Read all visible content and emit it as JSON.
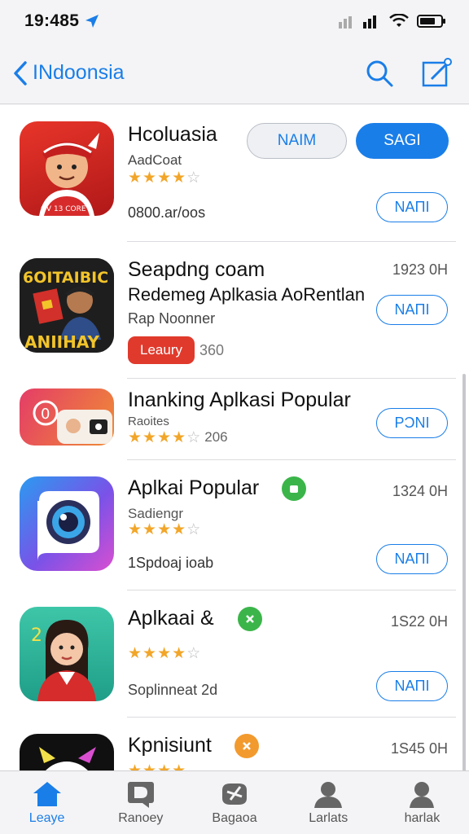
{
  "status": {
    "time": "19:485"
  },
  "nav": {
    "back_label": "INdoonsia"
  },
  "rows": [
    {
      "title": "Hcoluasia",
      "subtitle": "AadCoat",
      "meta": "0800.ar/oos",
      "btn_secondary": "NAIM",
      "btn_primary": "SAGI",
      "btn": "NAΠI",
      "rating": 4.5
    },
    {
      "title": "Seapdng coam",
      "subtitle": "Redemeg Aplkasia AoRentlan",
      "sub2": "Rap Noonner",
      "time": "1923 0H",
      "badge": "Leaury",
      "count": "360",
      "btn": "NAΠI",
      "icon_text_top": "6OITAIBIC",
      "icon_text_bottom": "ANIIHAY"
    },
    {
      "title": "Inanking Aplkasi Popular",
      "subtitle": "Raoites",
      "count": "206",
      "btn": "PƆNI",
      "rating": 4.5
    },
    {
      "title": "Aplkai Popular",
      "subtitle": "Sadiengr",
      "meta": "1Spdoaj ioab",
      "time": "1324 0H",
      "btn": "NAΠI",
      "rating": 4.5
    },
    {
      "title": "Aplkaai &",
      "meta": "Soplinneat 2d",
      "time": "1S22 0H",
      "btn": "NAΠI",
      "rating": 4.5
    },
    {
      "title": "Kpnisiunt",
      "time": "1S45 0H",
      "rating": 4.5
    }
  ],
  "tabs": [
    {
      "label": "Leaye",
      "icon": "home-icon"
    },
    {
      "label": "Ranoey",
      "icon": "media-icon"
    },
    {
      "label": "Bagaoa",
      "icon": "games-icon"
    },
    {
      "label": "Larlats",
      "icon": "person-icon"
    },
    {
      "label": "harlak",
      "icon": "profile-icon"
    }
  ],
  "colors": {
    "accent": "#1a7ee8",
    "star": "#f2a629",
    "badge_red": "#e03a2c",
    "badge_green": "#3bb54a",
    "badge_orange": "#f29a2e"
  }
}
